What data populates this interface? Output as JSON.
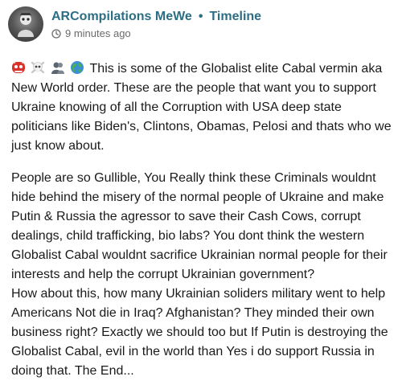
{
  "header": {
    "author": "ARCompilations MeWe",
    "separator": "•",
    "location": "Timeline",
    "timestamp": "9 minutes ago"
  },
  "icons": {
    "avatar": "avatar-icon",
    "clock": "clock-icon",
    "emojis": [
      "ogre-mask-emoji",
      "skull-crossbones-emoji",
      "silhouette-emoji",
      "globe-emoji"
    ]
  },
  "post": {
    "paragraph1_lines": [
      "This is some of the Globalist elite Cabal vermin aka",
      "New World order. These are the people that want you to support",
      "Ukraine knowing of all the Corruption with USA deep state",
      "politicians like Biden's, Clintons, Obamas, Pelosi and thats who we",
      "just know about."
    ],
    "paragraph2_lines": [
      "People are so Gullible, You Really think these Criminals wouldnt",
      "hide behind the misery of the normal people of Ukraine and make",
      "Putin & Russia the agressor to save their Cash Cows, corrupt",
      "dealings, child trafficking, bio labs? You dont think the western",
      "Globalist Cabal wouldnt sacrifice Ukrainian normal people for their",
      "interests and help the corrupt Ukrainian government?",
      "How about this, how many Ukrainian soliders military went to help",
      "Americans Not die in Iraq? Afghanistan? They minded their own",
      "business right? Exactly we should too but If Putin is destroying the",
      "Globalist Cabal, evil in the world than Yes i do support Russia in",
      "doing that. The End..."
    ]
  },
  "colors": {
    "author_link": "#2c6f84",
    "timestamp": "#6b6b6b",
    "text": "#1a1a1a"
  }
}
